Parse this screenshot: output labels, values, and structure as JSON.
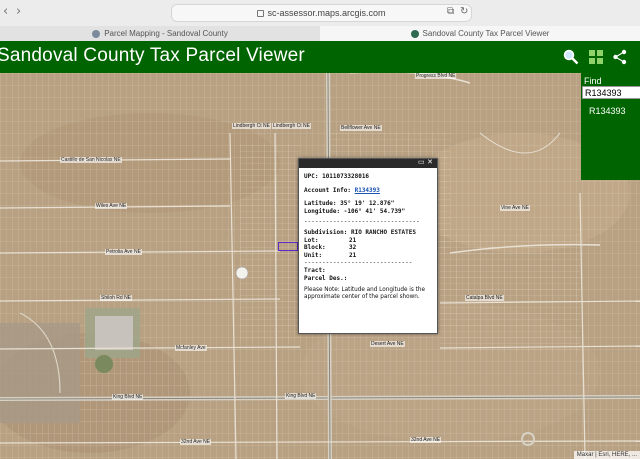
{
  "browser": {
    "url": "sc-assessor.maps.arcgis.com",
    "nav_back": "‹",
    "nav_forward": "›",
    "tabs": [
      {
        "label": "Parcel Mapping - Sandoval County",
        "active": false
      },
      {
        "label": "Sandoval County Tax Parcel Viewer",
        "active": true
      }
    ]
  },
  "header": {
    "title": "Sandoval County Tax Parcel Viewer",
    "icons": [
      "search-icon",
      "grid-icon",
      "share-icon"
    ]
  },
  "find": {
    "label": "Find",
    "value": "R134393",
    "result": "R134393"
  },
  "popup": {
    "upc_label": "UPC:",
    "upc_value": "1011073328016",
    "account_label": "Account Info:",
    "account_value": "R134393",
    "latitude_label": "Latitude:",
    "latitude_value": "35° 19' 12.876\"",
    "longitude_label": "Longitude:",
    "longitude_value": "-106° 41' 54.739\"",
    "separator": "--------------------------------",
    "subdivision_label": "Subdivision:",
    "subdivision_value": "RIO RANCHO ESTATES",
    "lot_label": "Lot:",
    "lot_value": "21",
    "block_label": "Block:",
    "block_value": "32",
    "unit_label": "Unit:",
    "unit_value": "21",
    "separator2": "------------------------------",
    "tract_label": "Tract:",
    "parcel_des_label": "Parcel Des.:",
    "note": "Please Note: Latitude and Longitude is the approximate center of the parcel shown."
  },
  "map": {
    "road_labels": [
      "Progress Blvd NE",
      "Lindbergh Ct NE",
      "Lindbergh Ct NE",
      "Bellflower Ave NE",
      "Castillo de San Nicolas NE",
      "Wiles Ave NE",
      "Petrolia Ave NE",
      "Shiloh Rd NE",
      "Mcfanley Ave",
      "Desert Ave NE",
      "King Blvd NE",
      "King Blvd NE",
      "Catalpa Blvd NE",
      "32nd Ave NE",
      "32nd Ave NE",
      "Vine Ave NE"
    ],
    "attribution": "Maxar | Esri, HERE, ..."
  },
  "colors": {
    "header_bg": "#006400",
    "selection": "#5b2cc9"
  }
}
